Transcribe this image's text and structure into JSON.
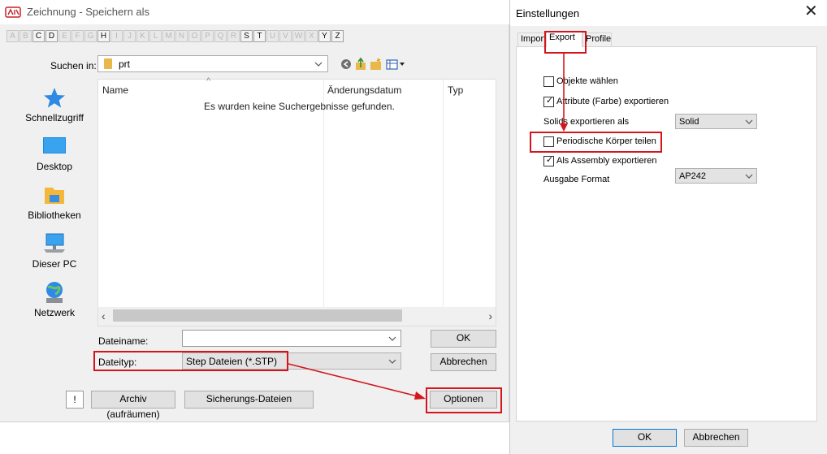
{
  "save_dialog": {
    "title": "Zeichnung - Speichern als",
    "letters": [
      {
        "t": "A",
        "on": false
      },
      {
        "t": "B",
        "on": false
      },
      {
        "t": "C",
        "on": true
      },
      {
        "t": "D",
        "on": true
      },
      {
        "t": "E",
        "on": false
      },
      {
        "t": "F",
        "on": false
      },
      {
        "t": "G",
        "on": false
      },
      {
        "t": "H",
        "on": true
      },
      {
        "t": "I",
        "on": false
      },
      {
        "t": "J",
        "on": false
      },
      {
        "t": "K",
        "on": false
      },
      {
        "t": "L",
        "on": false
      },
      {
        "t": "M",
        "on": false
      },
      {
        "t": "N",
        "on": false
      },
      {
        "t": "O",
        "on": false
      },
      {
        "t": "P",
        "on": false
      },
      {
        "t": "Q",
        "on": false
      },
      {
        "t": "R",
        "on": false
      },
      {
        "t": "S",
        "on": true
      },
      {
        "t": "T",
        "on": true
      },
      {
        "t": "U",
        "on": false
      },
      {
        "t": "V",
        "on": false
      },
      {
        "t": "W",
        "on": false
      },
      {
        "t": "X",
        "on": false
      },
      {
        "t": "Y",
        "on": true
      },
      {
        "t": "Z",
        "on": true
      }
    ],
    "lookin_label": "Suchen in:",
    "lookin_value": "prt",
    "places": [
      "Schnellzugriff",
      "Desktop",
      "Bibliotheken",
      "Dieser PC",
      "Netzwerk"
    ],
    "columns": {
      "name": "Name",
      "date": "Änderungsdatum",
      "type": "Typ"
    },
    "empty_message": "Es wurden keine Suchergebnisse gefunden.",
    "filename_label": "Dateiname:",
    "filename_value": "",
    "filetype_label": "Dateityp:",
    "filetype_value": "Step Dateien (*.STP)",
    "ok": "OK",
    "cancel": "Abbrechen",
    "options": "Optionen",
    "excl": "!",
    "archive": "Archiv (aufräumen)",
    "backup": "Sicherungs-Dateien"
  },
  "settings_dialog": {
    "title": "Einstellungen",
    "close": "✕",
    "tabs": {
      "import": "Import",
      "export": "Export",
      "profile": "Profile"
    },
    "opt_select": {
      "label": "Objekte wählen",
      "checked": false
    },
    "opt_attributes": {
      "label": "Attribute (Farbe) exportieren",
      "checked": true
    },
    "solids_label": "Solids exportieren als",
    "solids_value": "Solid",
    "opt_periodic": {
      "label": "Periodische Körper teilen",
      "checked": false
    },
    "opt_assembly": {
      "label": "Als Assembly exportieren",
      "checked": true
    },
    "format_label": "Ausgabe Format",
    "format_value": "AP242",
    "ok": "OK",
    "cancel": "Abbrechen"
  },
  "colors": {
    "annotation": "#d4161c",
    "accent": "#0078d7"
  },
  "icons": [
    "app-logo-icon",
    "folder-icon",
    "back-icon",
    "up-folder-icon",
    "new-folder-icon",
    "view-menu-icon",
    "star-icon",
    "desktop-icon",
    "library-icon",
    "pc-icon",
    "network-icon",
    "chevron-down-icon",
    "close-icon",
    "checkmark-icon"
  ]
}
